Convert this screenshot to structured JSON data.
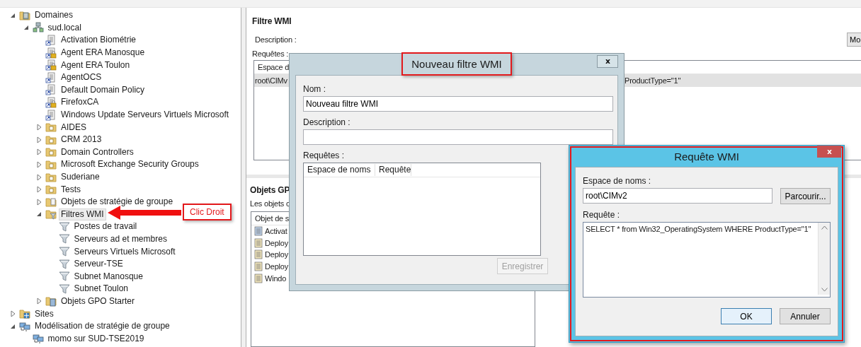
{
  "tree": [
    {
      "label": "Domaines",
      "kind": "domains",
      "expanded": true,
      "selected": false,
      "children": [
        {
          "label": "sud.local",
          "kind": "domain",
          "expanded": true,
          "selected": false,
          "children": [
            {
              "label": "Activation Biométrie",
              "kind": "gpo-link",
              "locked": false,
              "selected": false
            },
            {
              "label": "Agent ERA Manosque",
              "kind": "gpo-link",
              "locked": true,
              "selected": false
            },
            {
              "label": "Agent ERA Toulon",
              "kind": "gpo-link",
              "locked": true,
              "selected": false
            },
            {
              "label": "AgentOCS",
              "kind": "gpo-link",
              "locked": false,
              "selected": false
            },
            {
              "label": "Default Domain Policy",
              "kind": "gpo-link",
              "locked": false,
              "selected": false
            },
            {
              "label": "FirefoxCA",
              "kind": "gpo-link",
              "locked": true,
              "selected": false
            },
            {
              "label": "Windows Update Serveurs Virtuels Microsoft",
              "kind": "gpo-link",
              "locked": false,
              "selected": false
            },
            {
              "label": "AIDES",
              "kind": "ou",
              "expanded": false,
              "selected": false
            },
            {
              "label": "CRM 2013",
              "kind": "ou",
              "expanded": false,
              "selected": false
            },
            {
              "label": "Domain Controllers",
              "kind": "ou",
              "expanded": false,
              "selected": false
            },
            {
              "label": "Microsoft Exchange Security Groups",
              "kind": "ou",
              "expanded": false,
              "selected": false
            },
            {
              "label": "Suderiane",
              "kind": "ou",
              "expanded": false,
              "selected": false
            },
            {
              "label": "Tests",
              "kind": "ou",
              "expanded": false,
              "selected": false
            },
            {
              "label": "Objets de stratégie de groupe",
              "kind": "gpo-folder",
              "expanded": false,
              "selected": false
            },
            {
              "label": "Filtres WMI",
              "kind": "wmi-folder",
              "expanded": true,
              "selected": true,
              "children": [
                {
                  "label": "Postes de travail",
                  "kind": "wmi-filter",
                  "selected": false
                },
                {
                  "label": "Serveurs ad et membres",
                  "kind": "wmi-filter",
                  "selected": false
                },
                {
                  "label": "Serveurs Virtuels Microsoft",
                  "kind": "wmi-filter",
                  "selected": false
                },
                {
                  "label": "Serveur-TSE",
                  "kind": "wmi-filter",
                  "selected": false
                },
                {
                  "label": "Subnet Manosque",
                  "kind": "wmi-filter",
                  "selected": false
                },
                {
                  "label": "Subnet Toulon",
                  "kind": "wmi-filter",
                  "selected": false
                }
              ]
            },
            {
              "label": "Objets GPO Starter",
              "kind": "starter-folder",
              "expanded": false,
              "selected": false
            }
          ]
        }
      ]
    },
    {
      "label": "Sites",
      "kind": "sites",
      "expanded": false,
      "selected": false
    },
    {
      "label": "Modélisation de stratégie de groupe",
      "kind": "modeling",
      "expanded": true,
      "selected": false,
      "children": [
        {
          "label": "momo sur SUD-TSE2019",
          "kind": "modeling-result",
          "selected": false
        }
      ]
    }
  ],
  "details": {
    "title": "Filtre WMI",
    "description_label": "Description :",
    "edit_button": "Mo",
    "queries_label": "Requêtes :",
    "queries_table": {
      "columns": [
        "Espace d"
      ],
      "rows": [
        {
          "cells": [
            "root\\CIMv",
            "ProductType=\"1\""
          ],
          "selected": true
        }
      ]
    },
    "gpo_section": {
      "title": "Objets GP",
      "intro": "Les objets c",
      "columns": [
        "Objet de s"
      ],
      "rows": [
        {
          "label": "Activat",
          "kind": "active"
        },
        {
          "label": "Deploy",
          "kind": "plain"
        },
        {
          "label": "Deploy",
          "kind": "plain"
        },
        {
          "label": "Deploy",
          "kind": "plain"
        },
        {
          "label": "Windo",
          "kind": "plain"
        }
      ]
    }
  },
  "new_filter_dialog": {
    "title": "Nouveau filtre WMI",
    "title_highlighted": true,
    "name_label": "Nom :",
    "name_value": "Nouveau filtre WMI",
    "description_label": "Description :",
    "queries_label": "Requêtes :",
    "queries_columns": [
      "Espace de noms",
      "Requête"
    ],
    "save_button": {
      "label": "Enregistrer",
      "disabled": true
    }
  },
  "query_dialog": {
    "title": "Requête WMI",
    "highlighted": true,
    "namespace_label": "Espace de noms :",
    "namespace_value": "root\\CIMv2",
    "browse_button": "Parcourir...",
    "query_label": "Requête :",
    "query_value": "SELECT * from Win32_OperatingSystem WHERE ProductType=\"1\"",
    "buttons": [
      {
        "label": "OK",
        "default": true
      },
      {
        "label": "Annuler",
        "default": false
      }
    ]
  },
  "annotation": {
    "callout": "Clic Droit"
  }
}
